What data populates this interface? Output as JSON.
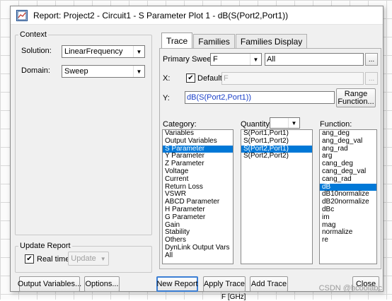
{
  "window": {
    "title": "Report: Project2 - Circuit1 - S Parameter Plot 1 - dB(S(Port2,Port1))"
  },
  "context": {
    "legend": "Context",
    "solution_label": "Solution:",
    "solution_value": "LinearFrequency",
    "domain_label": "Domain:",
    "domain_value": "Sweep"
  },
  "update_report": {
    "legend": "Update Report",
    "realtime_label": "Real time",
    "realtime_checked": true,
    "update_button": "Update"
  },
  "tabs": [
    {
      "label": "Trace",
      "active": true
    },
    {
      "label": "Families",
      "active": false
    },
    {
      "label": "Families Display",
      "active": false
    }
  ],
  "trace": {
    "primary_sweep_label": "Primary Sweep:",
    "primary_sweep_value": "F",
    "primary_sweep_range": "All",
    "ellipsis": "...",
    "x_label": "X:",
    "default_label": "Default",
    "default_checked": true,
    "x_value": "F",
    "y_label": "Y:",
    "y_value": "dB(S(Port2,Port1))",
    "range_function_line1": "Range",
    "range_function_line2": "Function..."
  },
  "category": {
    "label": "Category:",
    "items": [
      "Variables",
      "Output Variables",
      "S Parameter",
      "Y Parameter",
      "Z Parameter",
      "Voltage",
      "Current",
      "Return Loss",
      "VSWR",
      "ABCD Parameter",
      "H Parameter",
      "G Parameter",
      "Gain",
      "Stability",
      "Others",
      "DynLink Output Vars",
      "All"
    ],
    "selected": "S Parameter"
  },
  "quantity": {
    "label": "Quantity:",
    "filter_value": "",
    "items": [
      "S(Port1,Port1)",
      "S(Port1,Port2)",
      "S(Port2,Port1)",
      "S(Port2,Port2)"
    ],
    "selected": "S(Port2,Port1)"
  },
  "function": {
    "label": "Function:",
    "items": [
      "ang_deg",
      "ang_deg_val",
      "ang_rad",
      "arg",
      "cang_deg",
      "cang_deg_val",
      "cang_rad",
      "dB",
      "dB10normalize",
      "dB20normalize",
      "dBc",
      "im",
      "mag",
      "normalize",
      "re"
    ],
    "selected": "dB"
  },
  "buttons": {
    "output_variables": "Output Variables...",
    "options": "Options...",
    "new_report": "New Report",
    "apply_trace": "Apply Trace",
    "add_trace": "Add Trace",
    "close": "Close"
  },
  "background": {
    "axis_label": "F [GHz]",
    "watermark": "CSDN @hcoolabc"
  },
  "colors": {
    "selection": "#0078d7",
    "expression_text": "#1a3fc8",
    "focus_border": "#3c7fd4"
  }
}
